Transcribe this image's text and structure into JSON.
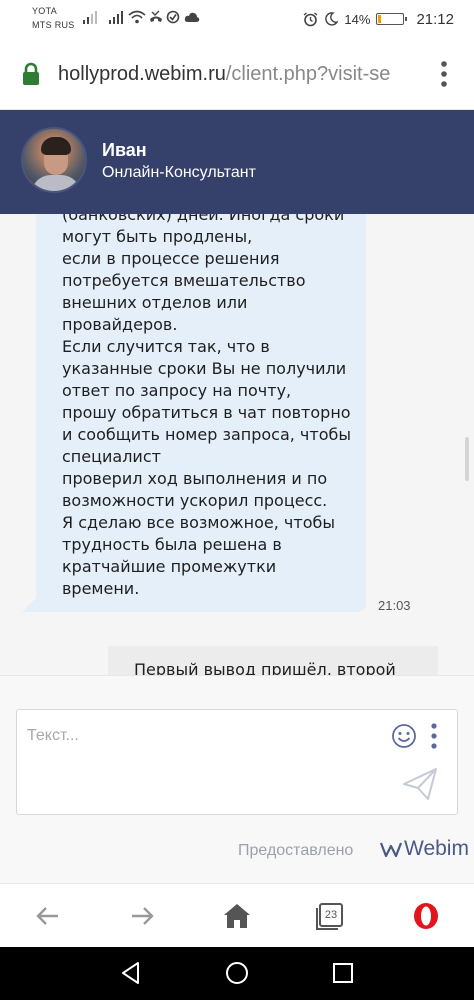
{
  "status_bar": {
    "carrier_1": "YOTA",
    "carrier_2": "MTS RUS",
    "battery": "14%",
    "battery_level": 0.14,
    "time": "21:12",
    "icons": [
      "signal-icon",
      "signal-icon",
      "wifi-icon",
      "missed-call-icon",
      "alarm-off-icon",
      "cloud-icon",
      "alarm-icon",
      "moon-icon",
      "battery-icon"
    ]
  },
  "browser": {
    "url_host": "hollyprod.webim.ru",
    "url_path": "/client.php?visit-se",
    "tabs_count": "23",
    "accent_color": "#2e7d32"
  },
  "chat_header": {
    "operator_name": "Иван",
    "operator_role": "Онлайн-Консультант",
    "background_color": "#35416a"
  },
  "messages": {
    "operator_message": "(банковских) дней. Иногда сроки\nмогут быть продлены,\nесли в процессе решения\nпотребуется вмешательство\nвнешних отделов или\nпровайдеров.\nЕсли случится так, что в\nуказанные сроки Вы не получили\nответ по запросу на почту,\nпрошу обратиться в чат повторно\nи сообщить номер запроса, чтобы\nспециалист\nпроверил ход выполнения и по\nвозможности ускорил процесс.\nЯ сделаю все возможное, чтобы\nтрудность была решена в\nкратчайшие промежутки\nвремени.",
    "operator_time": "21:03",
    "user_message": "Первый вывод пришёл, второй"
  },
  "input": {
    "placeholder": "Текст...",
    "powered_by": "Предоставлено",
    "brand": "Webim"
  }
}
